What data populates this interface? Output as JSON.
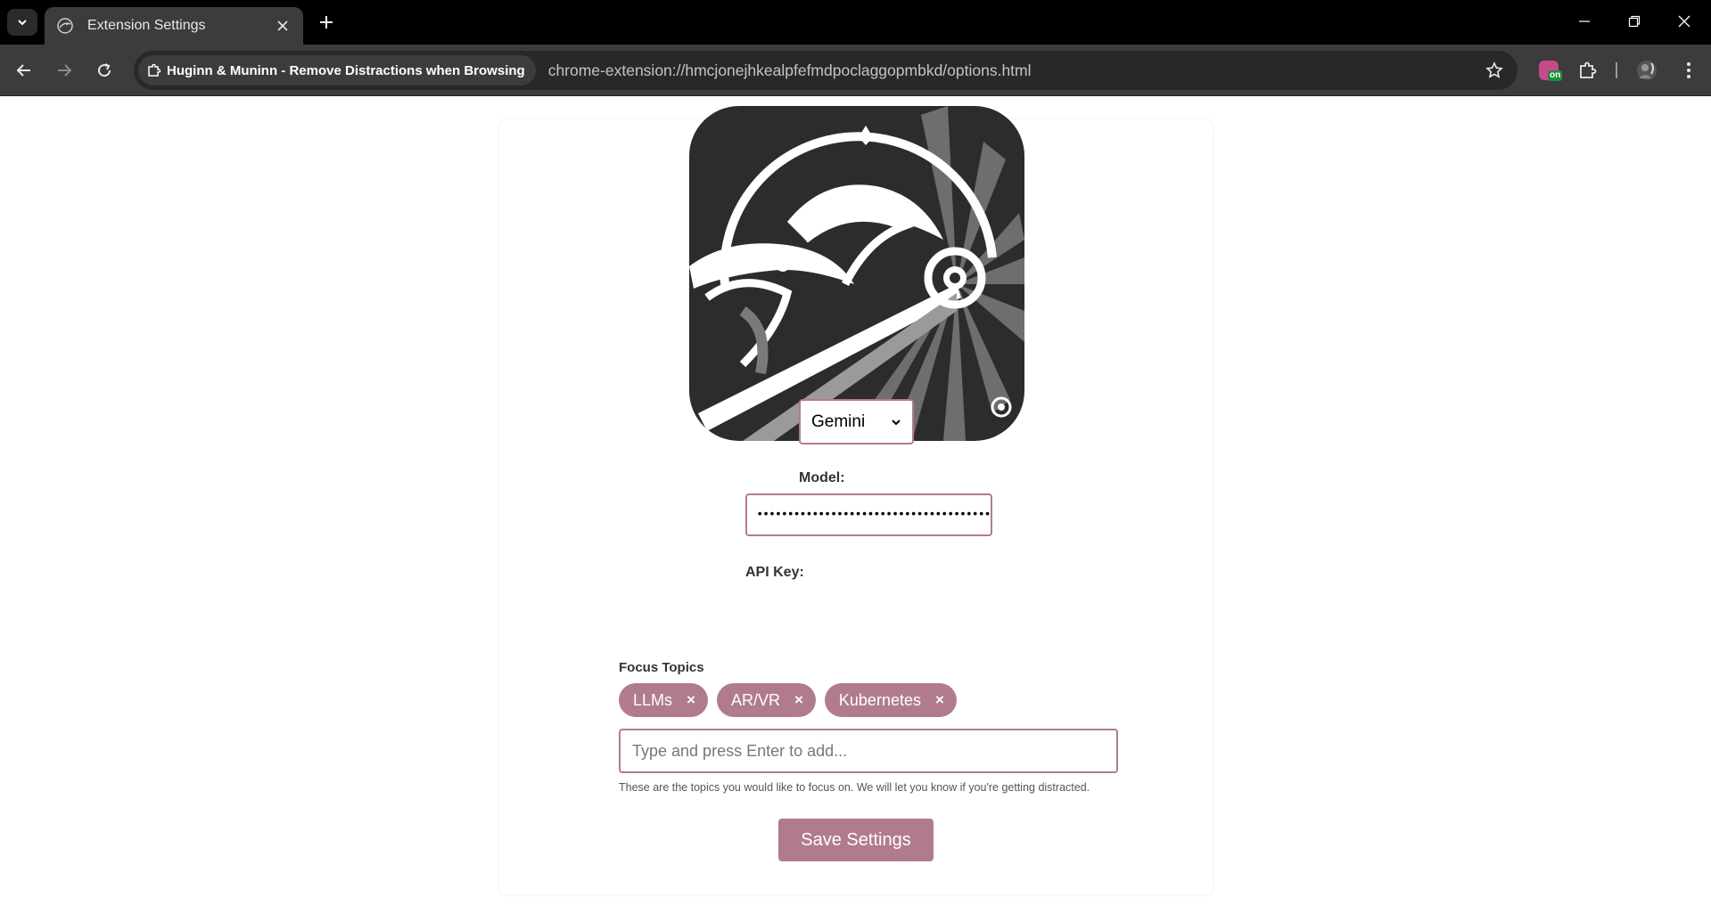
{
  "browser": {
    "tab": {
      "title": "Extension Settings"
    },
    "site_chip": "Huginn & Muninn - Remove Distractions when Browsing",
    "url": "chrome-extension://hmcjonejhkealpfefmdpoclaggopmbkd/options.html",
    "extension_badge": "on"
  },
  "settings": {
    "model_label": "Model:",
    "model_value": "Gemini",
    "api_key_label": "API Key:",
    "api_key_masked": "••••••••••••••••••••••••••••••••••••••",
    "topics_label": "Focus Topics",
    "topics": [
      {
        "label": "LLMs",
        "remove": "×"
      },
      {
        "label": "AR/VR",
        "remove": "×"
      },
      {
        "label": "Kubernetes",
        "remove": "×"
      }
    ],
    "topic_placeholder": "Type and press Enter to add...",
    "helper_text": "These are the topics you would like to focus on. We will let you know if you're getting distracted.",
    "save_label": "Save Settings"
  },
  "colors": {
    "accent": "#b07c8c",
    "chrome_dark": "#000000",
    "toolbar": "#3c3c3c",
    "logo_bg": "#2c2c2e"
  }
}
